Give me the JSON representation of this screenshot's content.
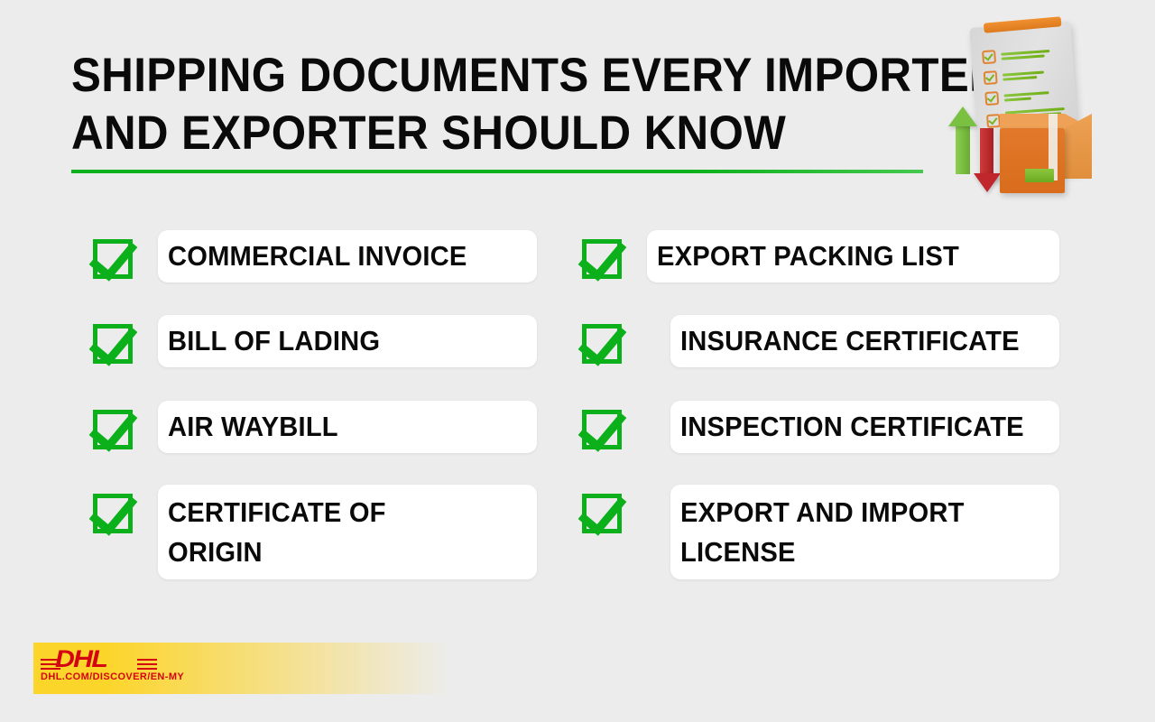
{
  "colors": {
    "background": "#ececec",
    "accent_green": "#0bb01a",
    "card_white": "#ffffff",
    "text_black": "#0a0a0a",
    "dhl_red": "#d40511",
    "dhl_yellow": "#fcd52b",
    "box_orange": "#e2792a"
  },
  "header": {
    "title_line_1": "SHIPPING DOCUMENTS EVERY IMPORTER",
    "title_line_2": "AND EXPORTER SHOULD KNOW"
  },
  "illustration": {
    "name": "clipboard-checklist-and-parcel-illustration",
    "clipboard_icon": "clipboard-icon",
    "arrow_up_icon": "arrow-up-icon",
    "arrow_down_icon": "arrow-down-icon",
    "parcel_icon": "parcel-box-icon"
  },
  "checklist": {
    "left_column": [
      {
        "label": "COMMERCIAL INVOICE",
        "checkbox_icon": "checkbox-checked-icon"
      },
      {
        "label": "BILL OF LADING",
        "checkbox_icon": "checkbox-checked-icon"
      },
      {
        "label": "AIR WAYBILL",
        "checkbox_icon": "checkbox-checked-icon"
      },
      {
        "label": "CERTIFICATE OF\nORIGIN",
        "checkbox_icon": "checkbox-checked-icon"
      }
    ],
    "right_column": [
      {
        "label": "EXPORT PACKING LIST",
        "checkbox_icon": "checkbox-checked-icon"
      },
      {
        "label": "INSURANCE CERTIFICATE",
        "checkbox_icon": "checkbox-checked-icon"
      },
      {
        "label": "INSPECTION CERTIFICATE",
        "checkbox_icon": "checkbox-checked-icon"
      },
      {
        "label": "EXPORT AND IMPORT\nLICENSE",
        "checkbox_icon": "checkbox-checked-icon"
      }
    ]
  },
  "footer": {
    "brand": "DHL",
    "url": "DHL.COM/DISCOVER/EN-MY"
  }
}
